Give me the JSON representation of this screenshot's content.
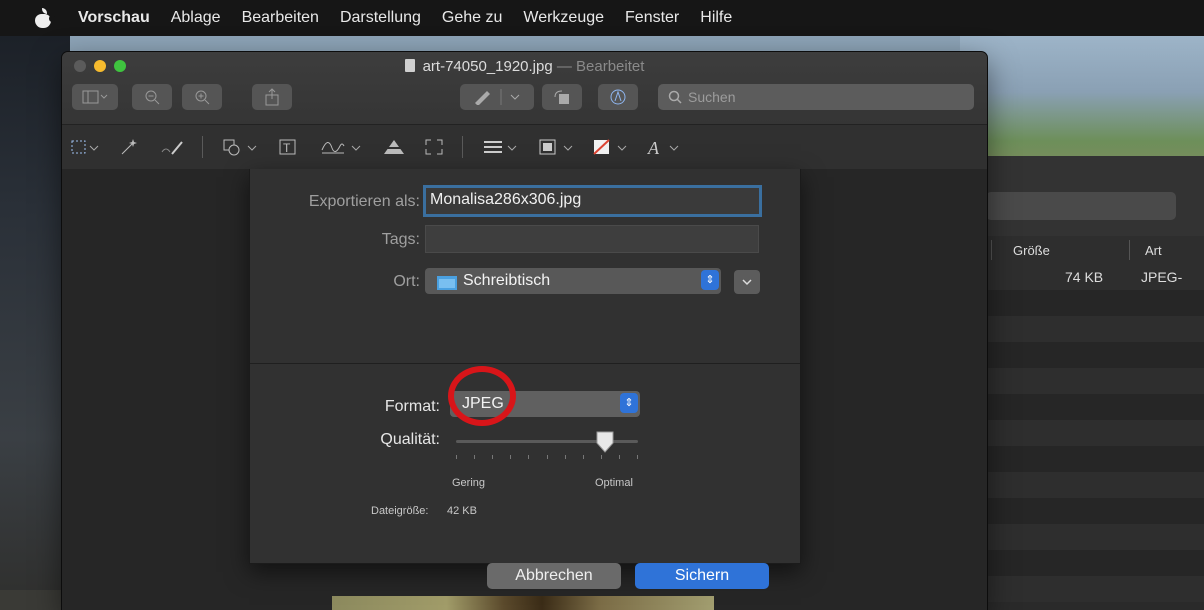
{
  "menubar": {
    "app": "Vorschau",
    "items": [
      "Ablage",
      "Bearbeiten",
      "Darstellung",
      "Gehe zu",
      "Werkzeuge",
      "Fenster",
      "Hilfe"
    ]
  },
  "window": {
    "title": "art-74050_1920.jpg",
    "title_status": "— Bearbeitet",
    "search_placeholder": "Suchen"
  },
  "finder": {
    "col_size": "Größe",
    "col_kind": "Art",
    "row_size": "74 KB",
    "row_kind": "JPEG-"
  },
  "export_sheet": {
    "export_as_label": "Exportieren als:",
    "filename": "Monalisa286x306.jpg",
    "tags_label": "Tags:",
    "tags_value": "",
    "location_label": "Ort:",
    "location_value": "Schreibtisch",
    "format_label": "Format:",
    "format_value": "JPEG",
    "quality_label": "Qualität:",
    "quality_level": 0.82,
    "quality_low": "Gering",
    "quality_high": "Optimal",
    "filesize_label": "Dateigröße:",
    "filesize_value": "42 KB",
    "cancel_label": "Abbrechen",
    "save_label": "Sichern"
  },
  "colors": {
    "accent": "#2f73d8",
    "highlight_ring": "#d81519",
    "focus_border": "#3a6f9f"
  }
}
